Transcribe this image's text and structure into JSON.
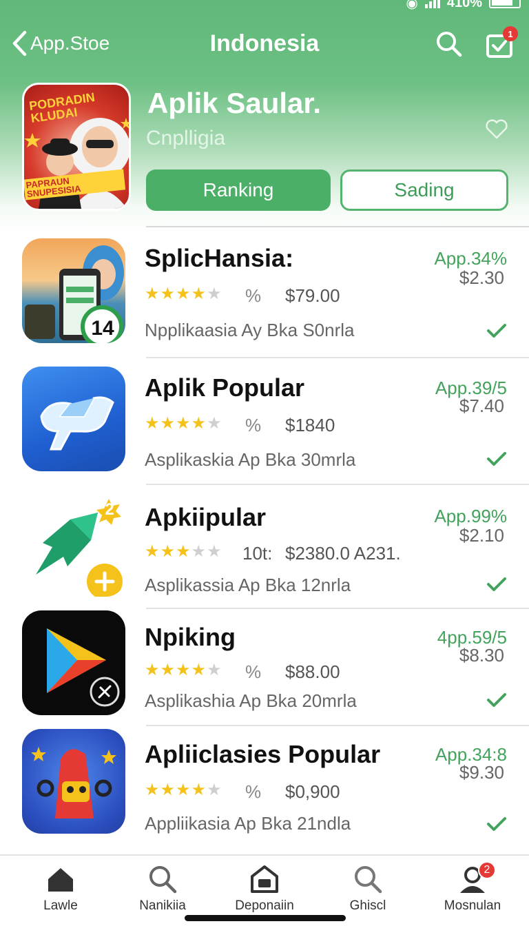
{
  "status_bar": {
    "battery_text": "410%"
  },
  "nav": {
    "back_label": "App.Stoe",
    "title": "Indonesia",
    "cart_badge": "1"
  },
  "feature": {
    "title": "Aplik Saular.",
    "subtitle": "Cnplligia",
    "icon_text_top": "PODRADIN KLUDAI",
    "icon_text_bottom": "PAPRAUN SNUPESISIA",
    "primary_button": "Ranking",
    "secondary_button": "Sading"
  },
  "apps": [
    {
      "name": "SplicHansia:",
      "rating": 3.5,
      "meta": "$79.00",
      "meta_prefix": "%",
      "desc": "Npplikaasia Ay Bka   S0nrla",
      "pct": "App.34%",
      "price": "$2.30",
      "icon": "phone-hijab-app-icon",
      "icon_badge": "14"
    },
    {
      "name": "Aplik Popular",
      "rating": 3.5,
      "meta": "$1840",
      "meta_prefix": "%",
      "desc": "Asplikaskia Ap Bka   30mrla",
      "pct": "App.39/5",
      "price": "$7.40",
      "icon": "blue-arrow-app-icon"
    },
    {
      "name": "Apkiipular",
      "rating": 2.5,
      "meta": "$2380.0 A231.",
      "meta_prefix": "10t:",
      "desc": "Asplikassia Ap Bka   12nrla",
      "pct": "App.99%",
      "price": "$2.10",
      "icon": "rocket-app-icon",
      "icon_badge": "2"
    },
    {
      "name": "Npiking",
      "rating": 4,
      "meta": "$88.00",
      "meta_prefix": "%",
      "desc": "Asplikashia Ap Bka   20mrla",
      "pct": "4pp.59/5",
      "price": "$8.30",
      "icon": "play-app-icon"
    },
    {
      "name": "Apliiclasies Popular",
      "rating": 3.5,
      "meta": "$0,900",
      "meta_prefix": "%",
      "desc": "Appliikasia Ap Bka   21ndla",
      "pct": "App.34:8",
      "price": "$9.30",
      "icon": "mascot-app-icon"
    }
  ],
  "tabs": [
    {
      "label": "Lawle",
      "icon": "home-icon"
    },
    {
      "label": "Nanikiia",
      "icon": "search-icon"
    },
    {
      "label": "Deponaiin",
      "icon": "store-icon"
    },
    {
      "label": "Ghiscl",
      "icon": "search-icon"
    },
    {
      "label": "Mosnulan",
      "icon": "profile-icon",
      "badge": "2"
    }
  ],
  "colors": {
    "brand_green": "#4caf68",
    "star": "#f5c21b",
    "badge_red": "#e53935"
  }
}
